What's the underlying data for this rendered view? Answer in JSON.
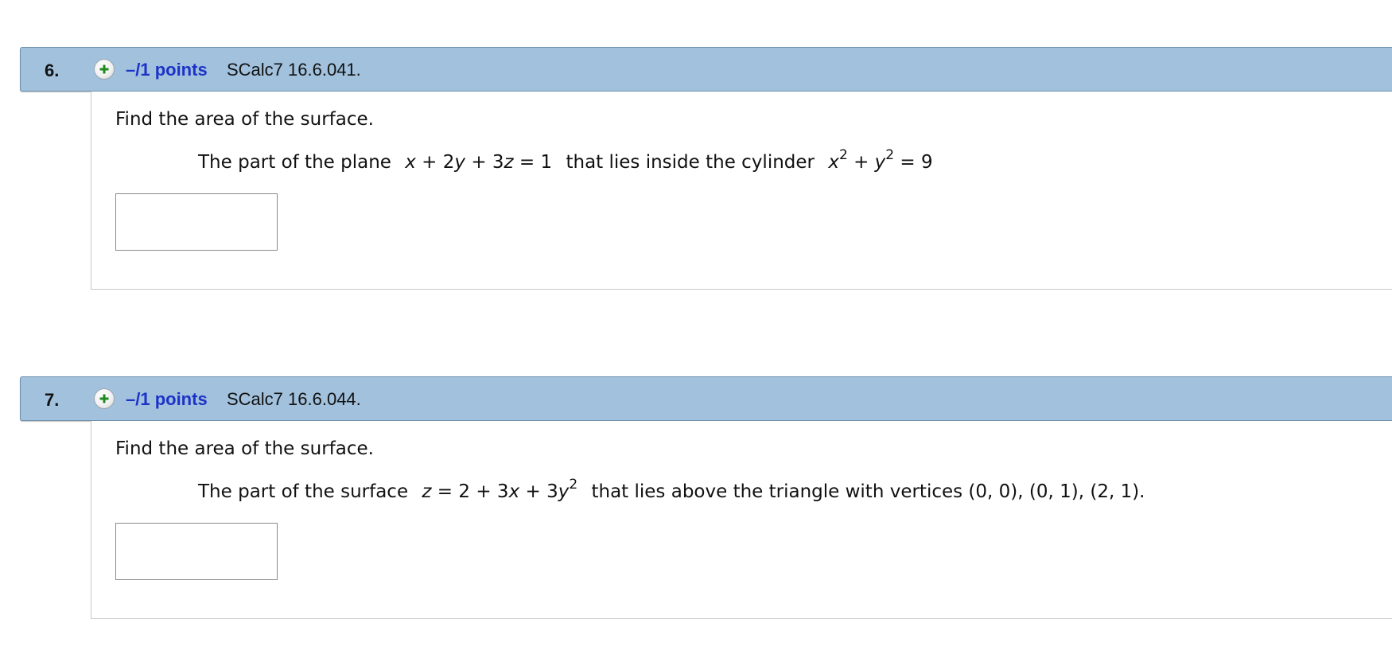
{
  "questions": [
    {
      "number": "6.",
      "points": "–/1 points",
      "reference": "SCalc7 16.6.041.",
      "prompt": "Find the area of the surface.",
      "text_before": "The part of the plane",
      "math_x": "x",
      "math_1": " + 2",
      "math_y": "y",
      "math_2": " + 3",
      "math_z": "z",
      "math_3": " = 1",
      "text_middle": "that lies inside the cylinder",
      "cyl_x": "x",
      "cyl_exp1": "2",
      "cyl_plus": " + ",
      "cyl_y": "y",
      "cyl_exp2": "2",
      "cyl_eq": " = 9",
      "answer_value": ""
    },
    {
      "number": "7.",
      "points": "–/1 points",
      "reference": "SCalc7 16.6.044.",
      "prompt": "Find the area of the surface.",
      "text_before": "The part of the surface",
      "math_z": "z",
      "math_1": " = 2 + 3",
      "math_x": "x",
      "math_2": " + 3",
      "math_y": "y",
      "math_exp": "2",
      "text_after": "that lies above the triangle with vertices (0, 0), (0, 1), (2, 1).",
      "answer_value": ""
    }
  ],
  "icons": {
    "expand": "plus-circle-icon",
    "plus_color": "#1e8a1e"
  },
  "colors": {
    "header_bg": "#a1c1dd",
    "points_link": "#1d33c7"
  }
}
